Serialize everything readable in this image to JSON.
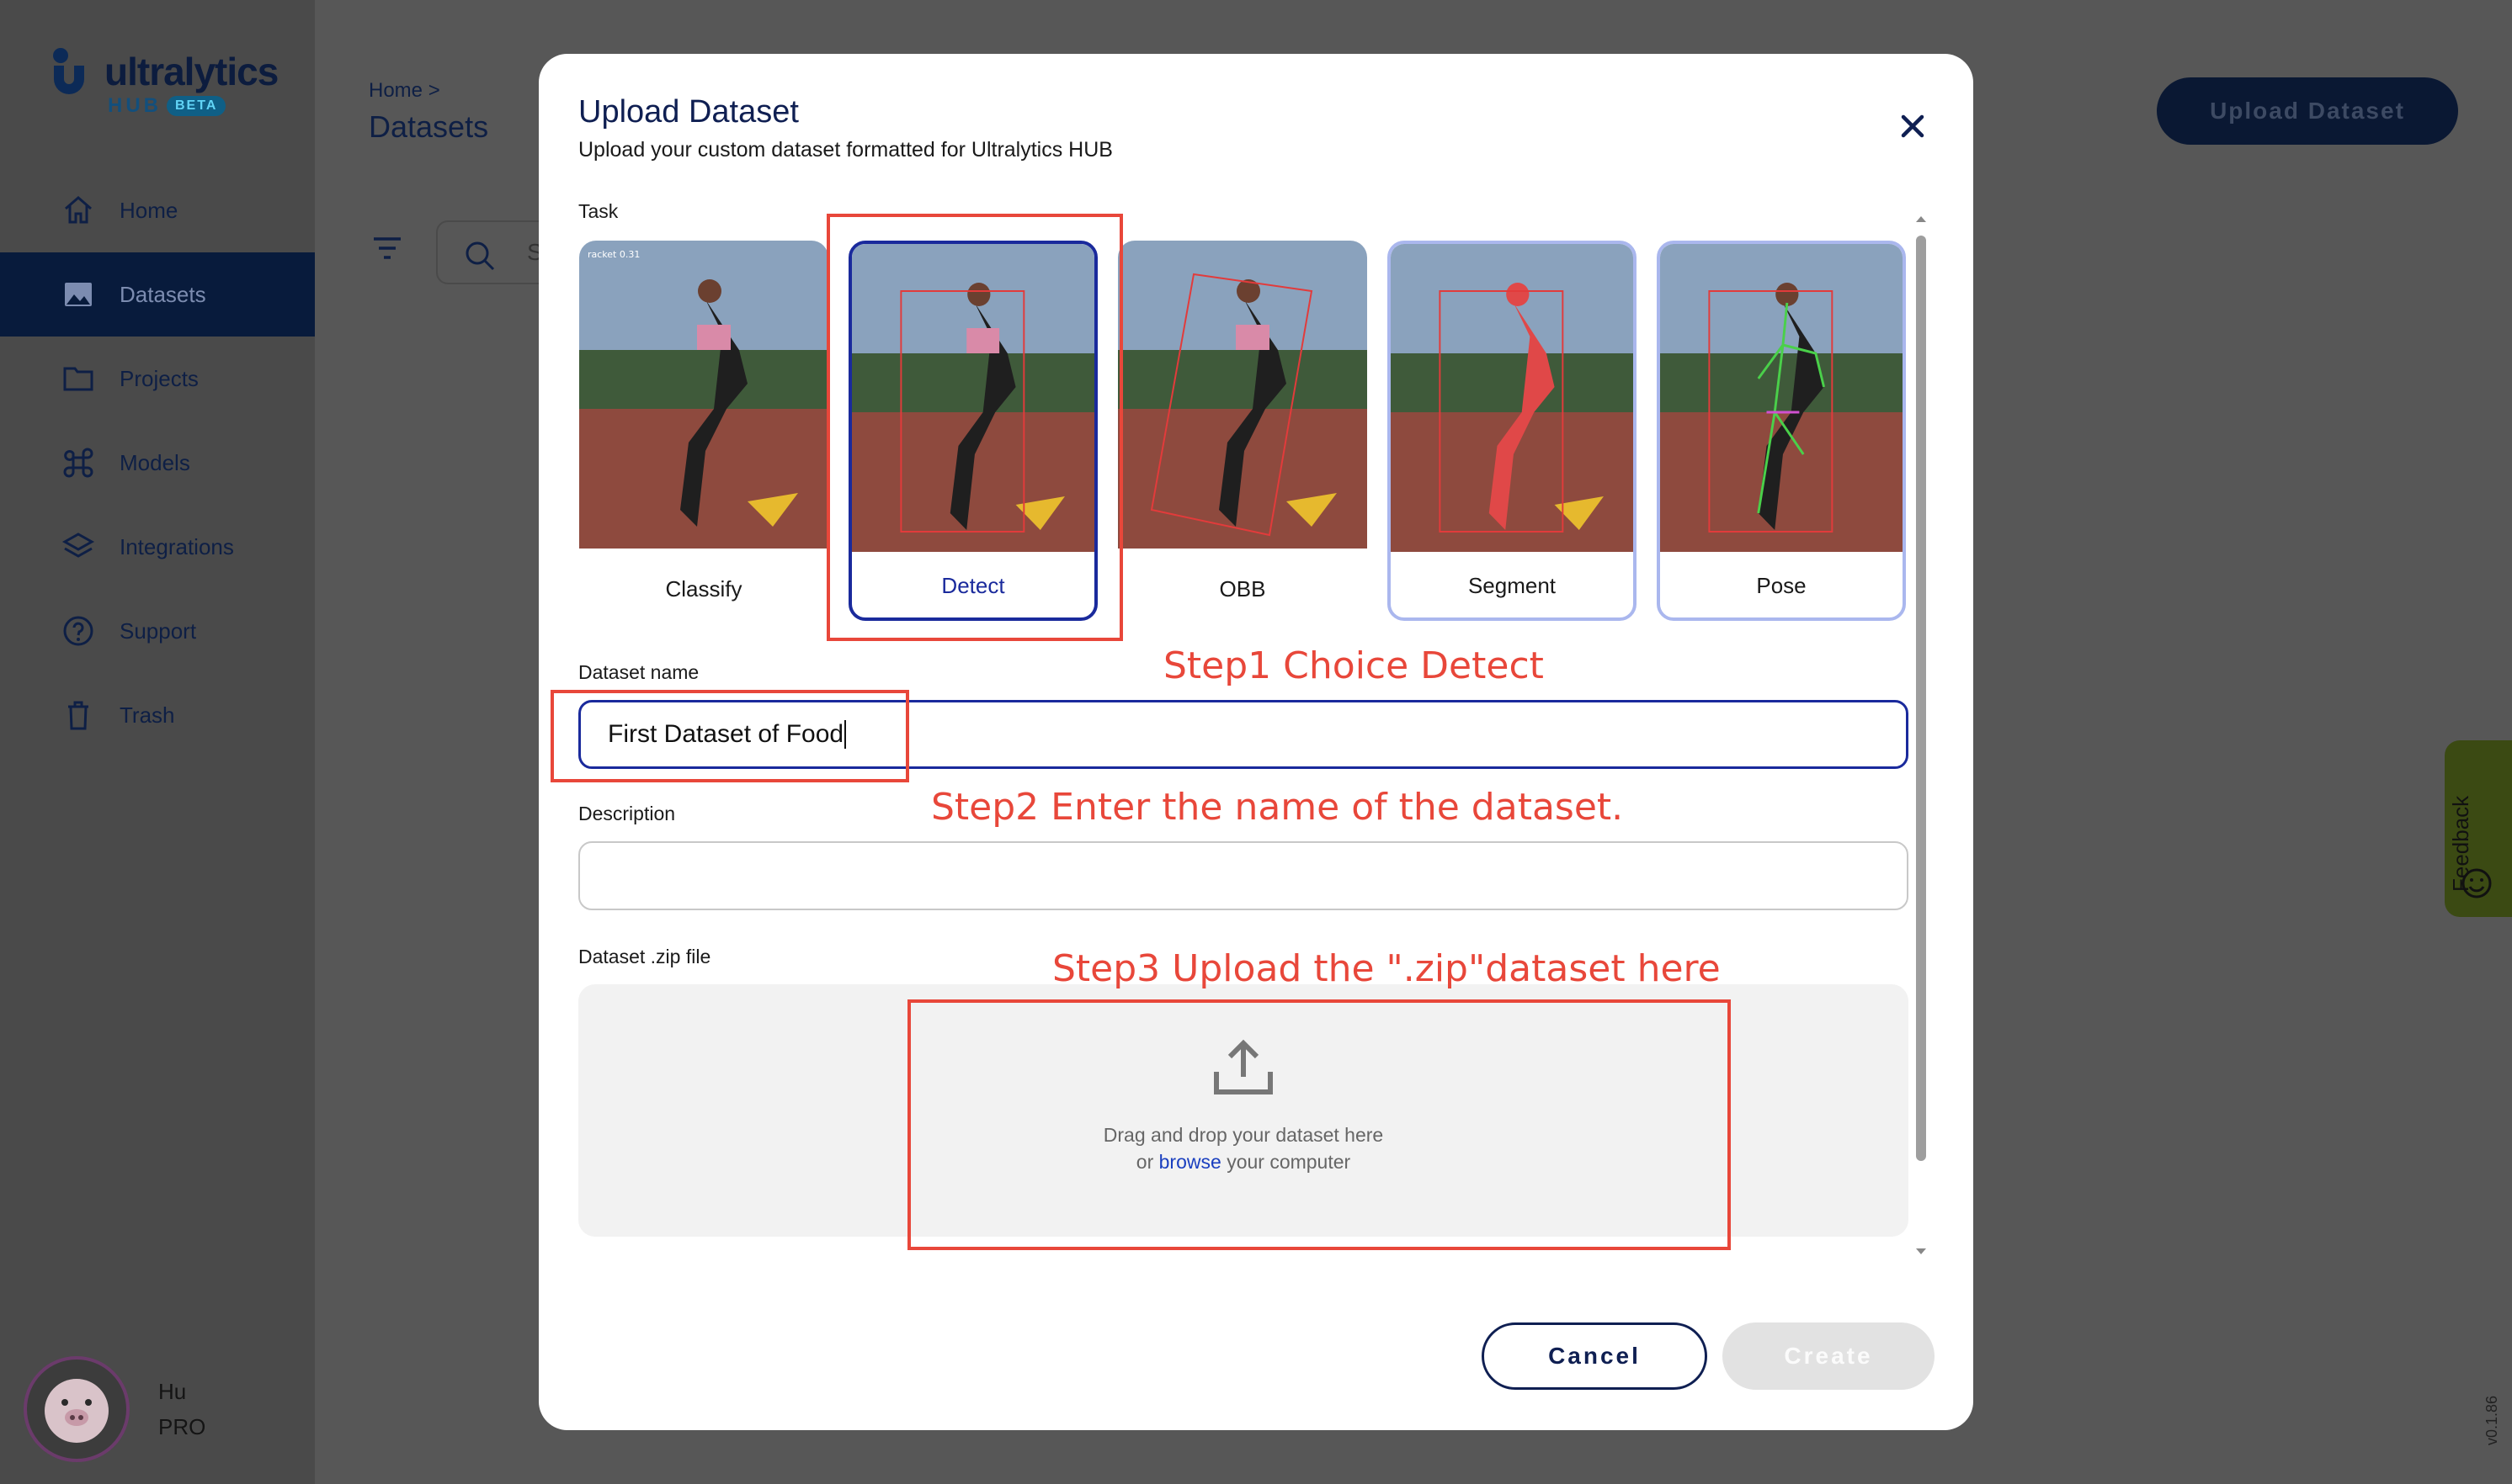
{
  "app": {
    "logo_text": "ultralytics",
    "logo_hub": "HUB",
    "logo_badge": "BETA"
  },
  "sidebar": {
    "items": [
      {
        "label": "Home",
        "icon": "home-icon"
      },
      {
        "label": "Datasets",
        "icon": "image-icon",
        "active": true
      },
      {
        "label": "Projects",
        "icon": "folder-icon"
      },
      {
        "label": "Models",
        "icon": "command-icon"
      },
      {
        "label": "Integrations",
        "icon": "layers-icon"
      },
      {
        "label": "Support",
        "icon": "help-icon"
      },
      {
        "label": "Trash",
        "icon": "trash-icon"
      }
    ]
  },
  "user": {
    "name": "Hu",
    "plan": "PRO"
  },
  "header": {
    "breadcrumb": "Home >",
    "title": "Datasets",
    "search_placeholder": "S",
    "upload_button": "Upload Dataset"
  },
  "feedback": {
    "label": "Feedback"
  },
  "version": "v0.1.86",
  "modal": {
    "title": "Upload Dataset",
    "subtitle": "Upload your custom dataset formatted for Ultralytics HUB",
    "task_label": "Task",
    "tasks": [
      {
        "label": "Classify",
        "selected": false
      },
      {
        "label": "Detect",
        "selected": true
      },
      {
        "label": "OBB",
        "selected": false
      },
      {
        "label": "Segment",
        "selected": false
      },
      {
        "label": "Pose",
        "selected": false
      }
    ],
    "name_label": "Dataset name",
    "name_value": "First Dataset of Food",
    "description_label": "Description",
    "description_value": "",
    "zip_label": "Dataset .zip file",
    "drop_line1": "Drag and drop your dataset here",
    "drop_or": "or",
    "drop_browse": "browse",
    "drop_rest": "your computer",
    "cancel_label": "Cancel",
    "create_label": "Create"
  },
  "annotations": {
    "step1": "Step1 Choice Detect",
    "step2": "Step2 Enter the name of the dataset.",
    "step3": "Step3 Upload the \".zip\"dataset here"
  },
  "colors": {
    "accent": "#1a2a9c",
    "annotation": "#e8473a",
    "nav_active": "#081b3c"
  }
}
